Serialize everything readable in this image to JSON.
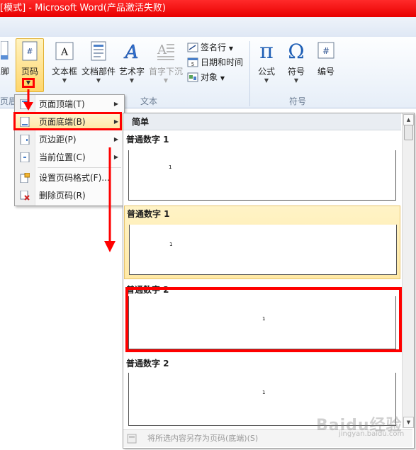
{
  "window": {
    "title": "[模式] - Microsoft Word(产品激活失败)"
  },
  "ribbon": {
    "buttons": {
      "partial_left": "脚",
      "page_number": "页码",
      "text_box": "文本框",
      "quick_parts": "文档部件",
      "wordart": "艺术字",
      "drop_cap": "首字下沉",
      "equation": "公式",
      "symbol": "符号",
      "number": "编号"
    },
    "small_buttons": {
      "signature_line": "签名行",
      "date_time": "日期和时间",
      "object": "对象"
    },
    "groups": {
      "header_footer_partial": "页眉",
      "text": "文本",
      "symbols": "符号"
    },
    "colors": {
      "active_button": "#ffd66b",
      "highlight_red": "#ff0000"
    }
  },
  "menu": {
    "items": [
      {
        "label": "页面顶端(T)",
        "has_submenu": true
      },
      {
        "label": "页面底端(B)",
        "has_submenu": true,
        "active": true
      },
      {
        "label": "页边距(P)",
        "has_submenu": true
      },
      {
        "label": "当前位置(C)",
        "has_submenu": true
      },
      {
        "label": "设置页码格式(F)...",
        "has_submenu": false
      },
      {
        "label": "删除页码(R)",
        "has_submenu": false
      }
    ]
  },
  "gallery": {
    "section_header": "简单",
    "items": [
      {
        "title": "普通数字 1",
        "number": "1",
        "align": "left"
      },
      {
        "title": "普通数字 1",
        "number": "1",
        "align": "left",
        "hover": true
      },
      {
        "title": "普通数字 2",
        "number": "1",
        "align": "center"
      },
      {
        "title": "普通数字 2",
        "number": "1",
        "align": "center"
      }
    ],
    "footer_action": "将所选内容另存为页码(底端)(S)"
  },
  "watermark": {
    "text": "Baidu经验",
    "sub": "jingyan.baidu.com"
  }
}
